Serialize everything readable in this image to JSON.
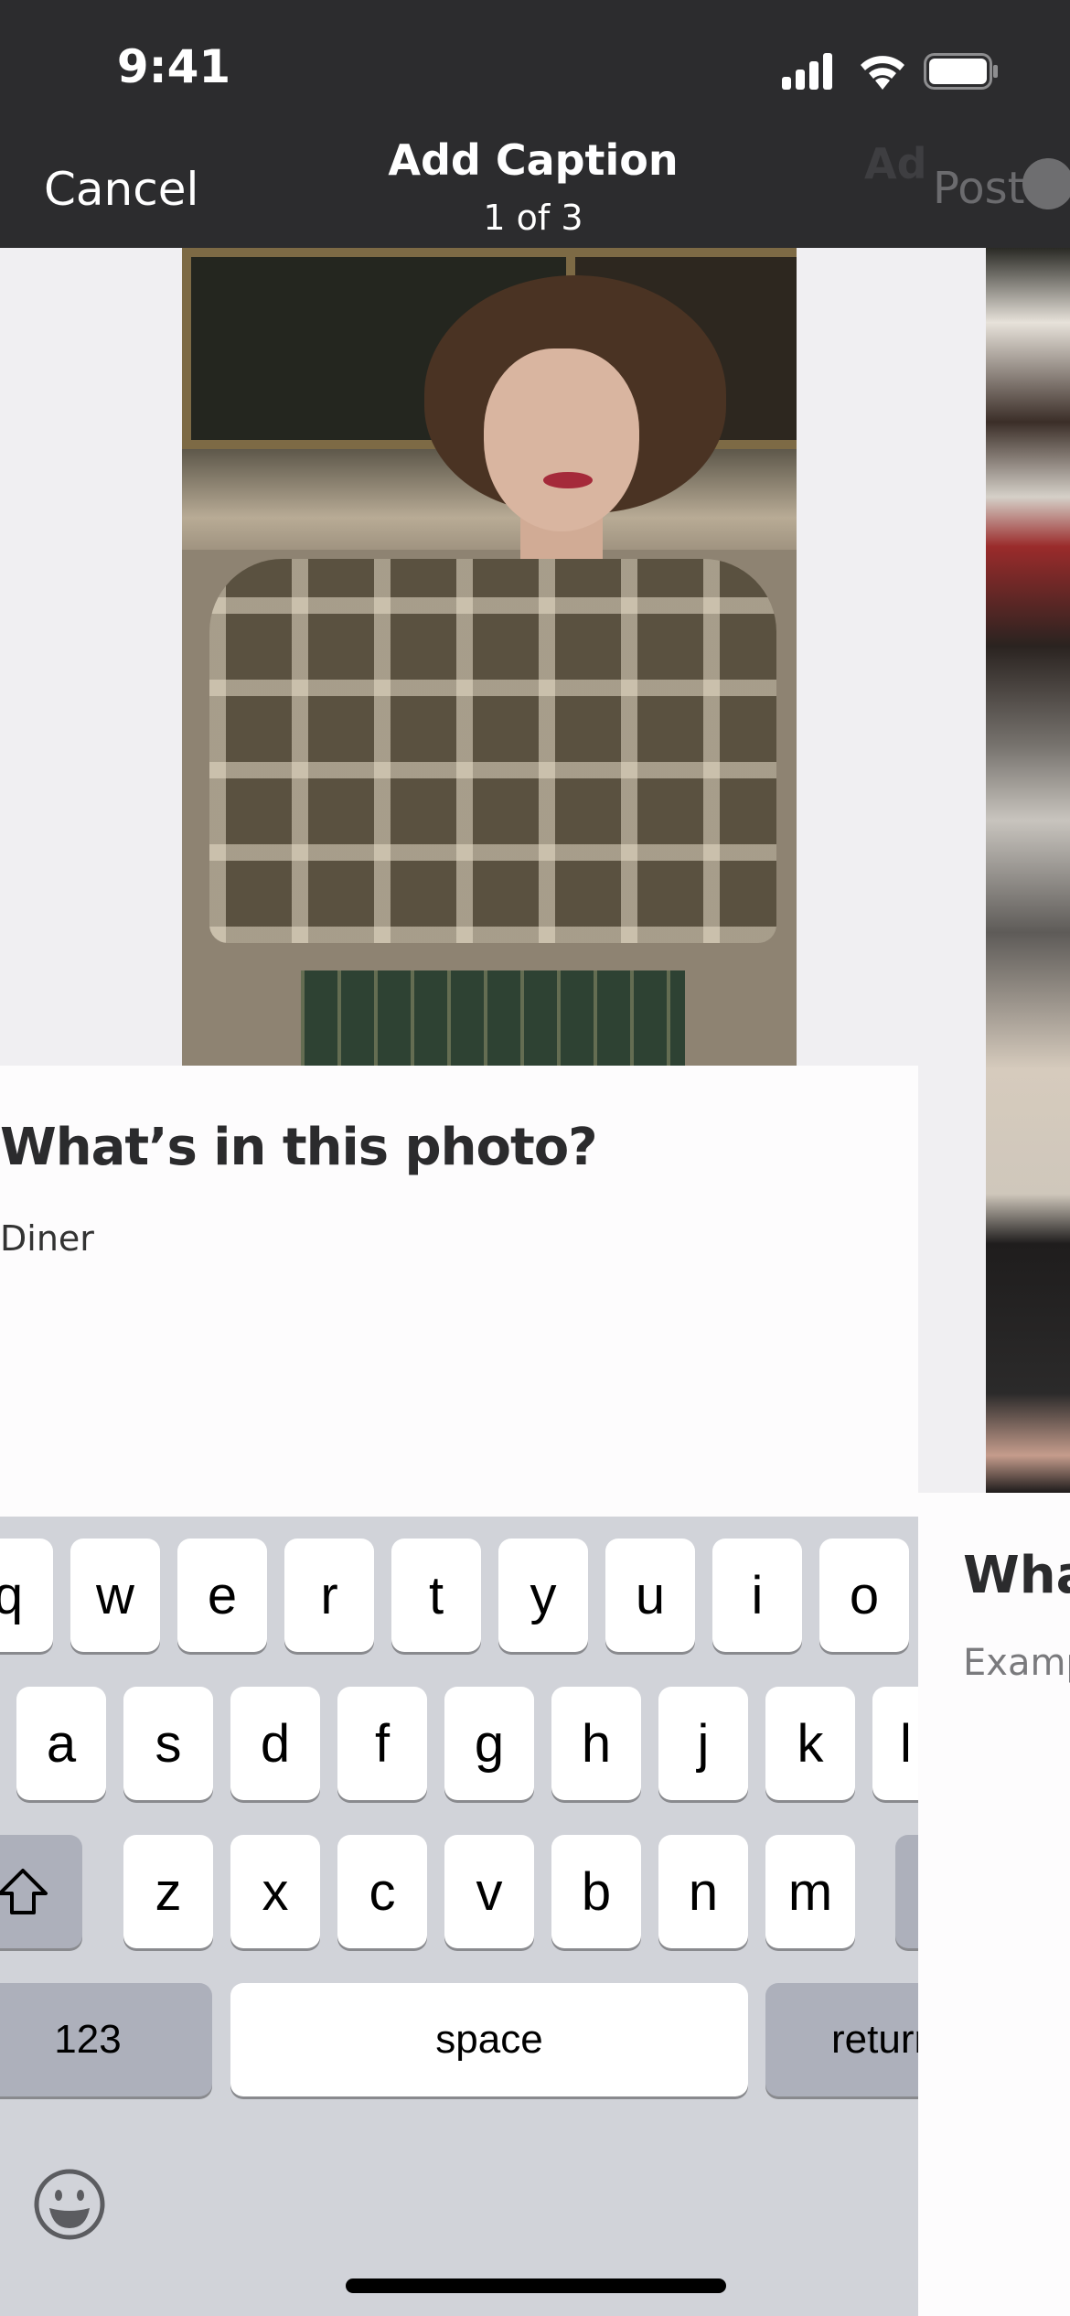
{
  "status_bar": {
    "time": "9:41",
    "icons": [
      "cellular-signal-icon",
      "wifi-icon",
      "battery-icon"
    ]
  },
  "header": {
    "cancel_label": "Cancel",
    "title": "Add Caption",
    "subtitle": "1 of 3",
    "next_title_ghost": "Ad",
    "post_label": "Post",
    "post_state": "loading"
  },
  "current_item": {
    "photo_alt": "Woman with short curly hair in a plaid shirt sitting on a couch",
    "question": "What’s in this photo?",
    "answer": "Diner"
  },
  "next_item": {
    "question": "Wha",
    "placeholder": "Examp"
  },
  "keyboard": {
    "row1": [
      "q",
      "w",
      "e",
      "r",
      "t",
      "y",
      "u",
      "i",
      "o"
    ],
    "row2": [
      "a",
      "s",
      "d",
      "f",
      "g",
      "h",
      "j",
      "k",
      "l"
    ],
    "row3": [
      "z",
      "x",
      "c",
      "v",
      "b",
      "n",
      "m"
    ],
    "numbers_label": "123",
    "space_label": "space",
    "return_label": "return"
  },
  "colors": {
    "header_bg": "#2c2c2e",
    "keyboard_bg": "#d1d3d9",
    "post_disabled": "#6b6b6e"
  }
}
